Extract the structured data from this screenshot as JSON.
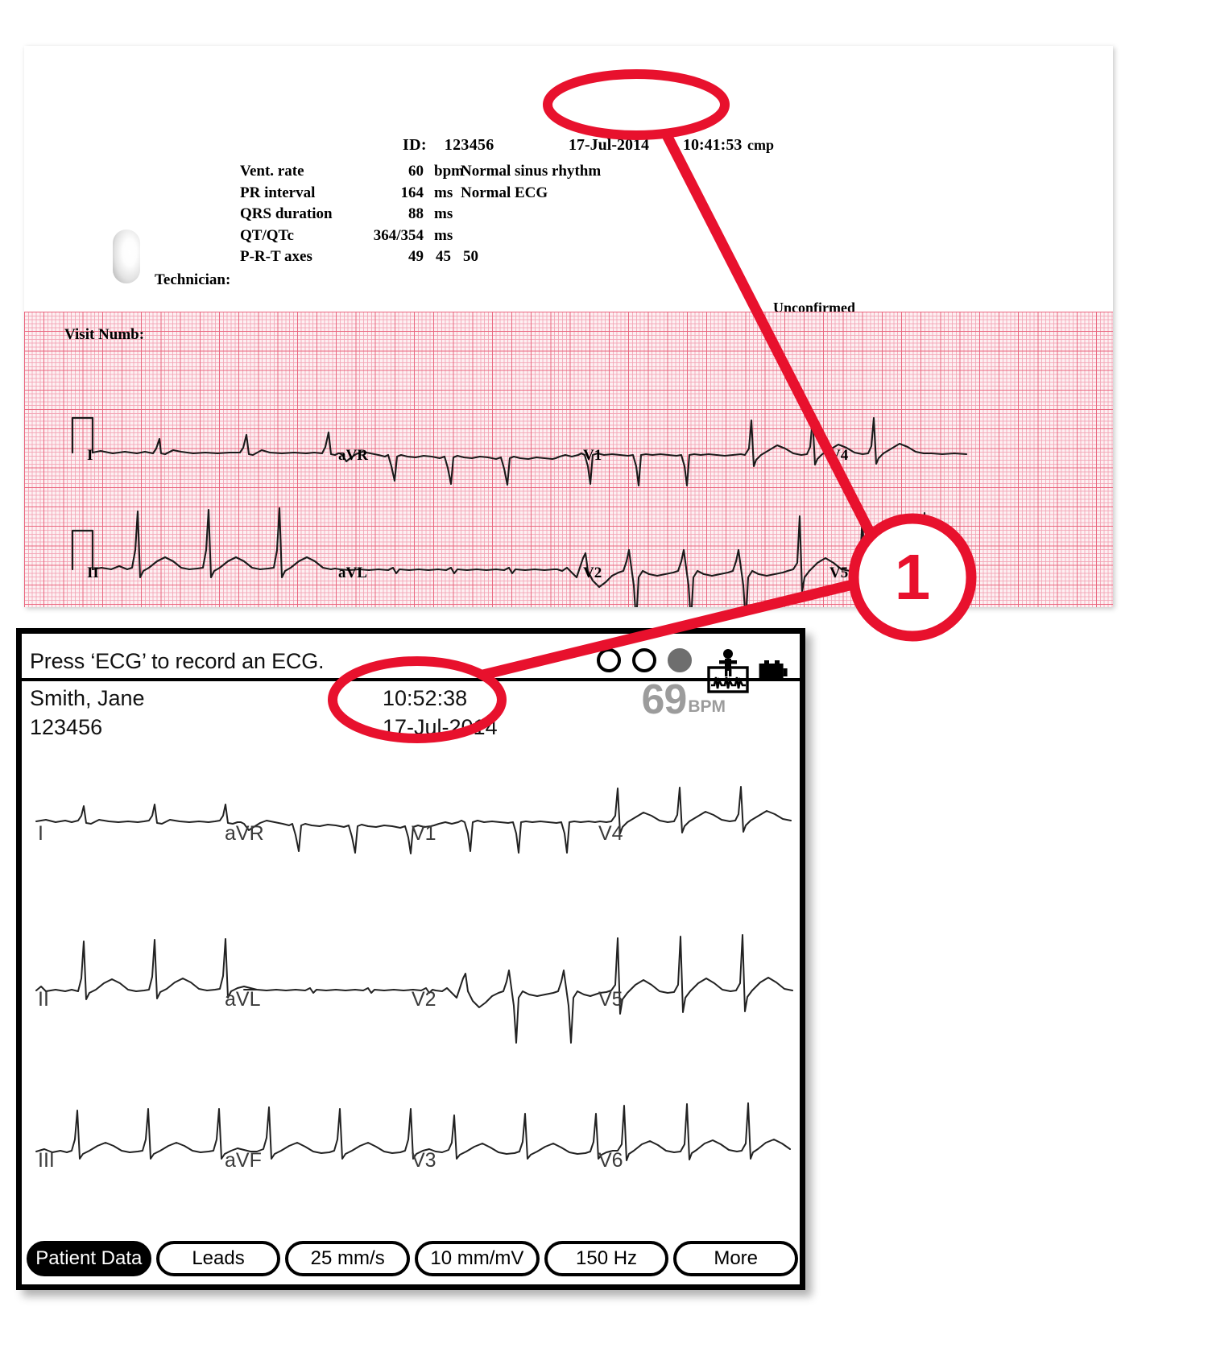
{
  "report": {
    "id_label": "ID:",
    "id_value": "123456",
    "date": "17-Jul-2014",
    "time": "10:41:53",
    "cmp": "cmp",
    "measurements": [
      {
        "name": "Vent. rate",
        "value": "60",
        "unit": "bpm"
      },
      {
        "name": "PR interval",
        "value": "164",
        "unit": "ms"
      },
      {
        "name": "QRS duration",
        "value": "88",
        "unit": "ms"
      },
      {
        "name": "QT/QTc",
        "value": "364/354",
        "unit": "ms"
      }
    ],
    "axes": {
      "name": "P-R-T axes",
      "p": "49",
      "r": "45",
      "t": "50"
    },
    "interpretation": [
      "Normal sinus rhythm",
      "Normal ECG"
    ],
    "technician_label": "Technician:",
    "unconfirmed_label": "Unconfirmed",
    "visit_numb_label": "Visit Numb:",
    "strip_leads_row1": [
      "I",
      "aVR",
      "V1",
      "V4"
    ],
    "strip_leads_row2": [
      "II",
      "aVL",
      "V2",
      "V5"
    ]
  },
  "device": {
    "message": "Press ‘ECG’ to record an ECG.",
    "patient_name": "Smith, Jane",
    "patient_id": "123456",
    "time": "10:52:38",
    "date": "17-Jul-2014",
    "heart_rate": "69",
    "heart_rate_unit": "BPM",
    "status_icons": [
      "circle-outline",
      "circle-outline",
      "circle-filled",
      "patient-electrodes-icon",
      "battery-icon"
    ],
    "leads": [
      [
        "I",
        "aVR",
        "V1",
        "V4"
      ],
      [
        "II",
        "aVL",
        "V2",
        "V5"
      ],
      [
        "III",
        "aVF",
        "V3",
        "V6"
      ]
    ],
    "softkeys": [
      {
        "label": "Patient Data",
        "active": true
      },
      {
        "label": "Leads",
        "active": false
      },
      {
        "label": "25 mm/s",
        "active": false
      },
      {
        "label": "10 mm/mV",
        "active": false
      },
      {
        "label": "150 Hz",
        "active": false
      },
      {
        "label": "More",
        "active": false
      }
    ]
  },
  "annotation": {
    "callout_number": "1",
    "accent_color": "#e8112d"
  }
}
